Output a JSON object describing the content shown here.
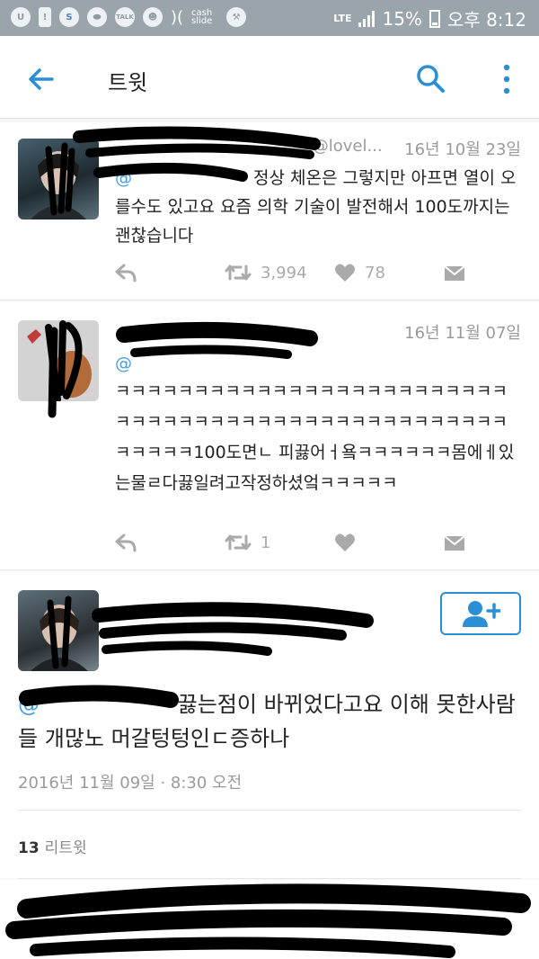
{
  "status_bar": {
    "network": "LTE",
    "battery": "15%",
    "time": "오후 8:12",
    "notification_icons": [
      "u-plus-icon",
      "alert-icon",
      "s-icon",
      "pill-icon",
      "talk-icon",
      "face-icon",
      "pair-icon",
      "cash-slide-icon",
      "wrench-icon"
    ],
    "talk_label": "TALK",
    "cash_label": "cash slide"
  },
  "appbar": {
    "title": "트윗",
    "back_icon": "arrow-left-icon",
    "search_icon": "search-icon",
    "more_icon": "more-vertical-icon",
    "accent_color": "#2b8fd6"
  },
  "tweets": [
    {
      "handle": "@lovel...",
      "date": "16년 10월 23일",
      "mention": "@",
      "text": "정상 체온은 그렇지만 아프면 열이 오를수도 있고요 요즘 의학 기술이 발전해서 100도까지는 괜찮습니다",
      "retweet_count": "3,994",
      "like_count": "78"
    },
    {
      "handle": "",
      "date": "16년 11월 07일",
      "mention": "@",
      "text": "ㅋㅋㅋㅋㅋㅋㅋㅋㅋㅋㅋㅋㅋㅋㅋㅋㅋㅋㅋㅋㅋㅋㅋㅋㅋㅋㅋㅋㅋㅋㅋㅋㅋㅋㅋㅋㅋㅋㅋㅋㅋㅋㅋㅋㅋㅋㅋㅋㅋㅋㅋㅋㅋㅋㅋ100도면ㄴ 피끓어ㅓ욬ㅋㅋㅋㅋㅋㅋ몸에ㅔ있는물ㄹ다끓일려고작정하셨엌ㅋㅋㅋㅋㅋ",
      "retweet_count": "1",
      "like_count": ""
    }
  ],
  "main_tweet": {
    "mention": "@",
    "text": "끓는점이 바뀌었다고요 이해 못한사람들 개많노 머갈텅텅인ㄷ증하나",
    "date": "2016년 11월 09일 · 8:30 오전",
    "retweet_count": "13",
    "retweet_label": "리트윗",
    "follow_icon": "add-user-icon"
  }
}
